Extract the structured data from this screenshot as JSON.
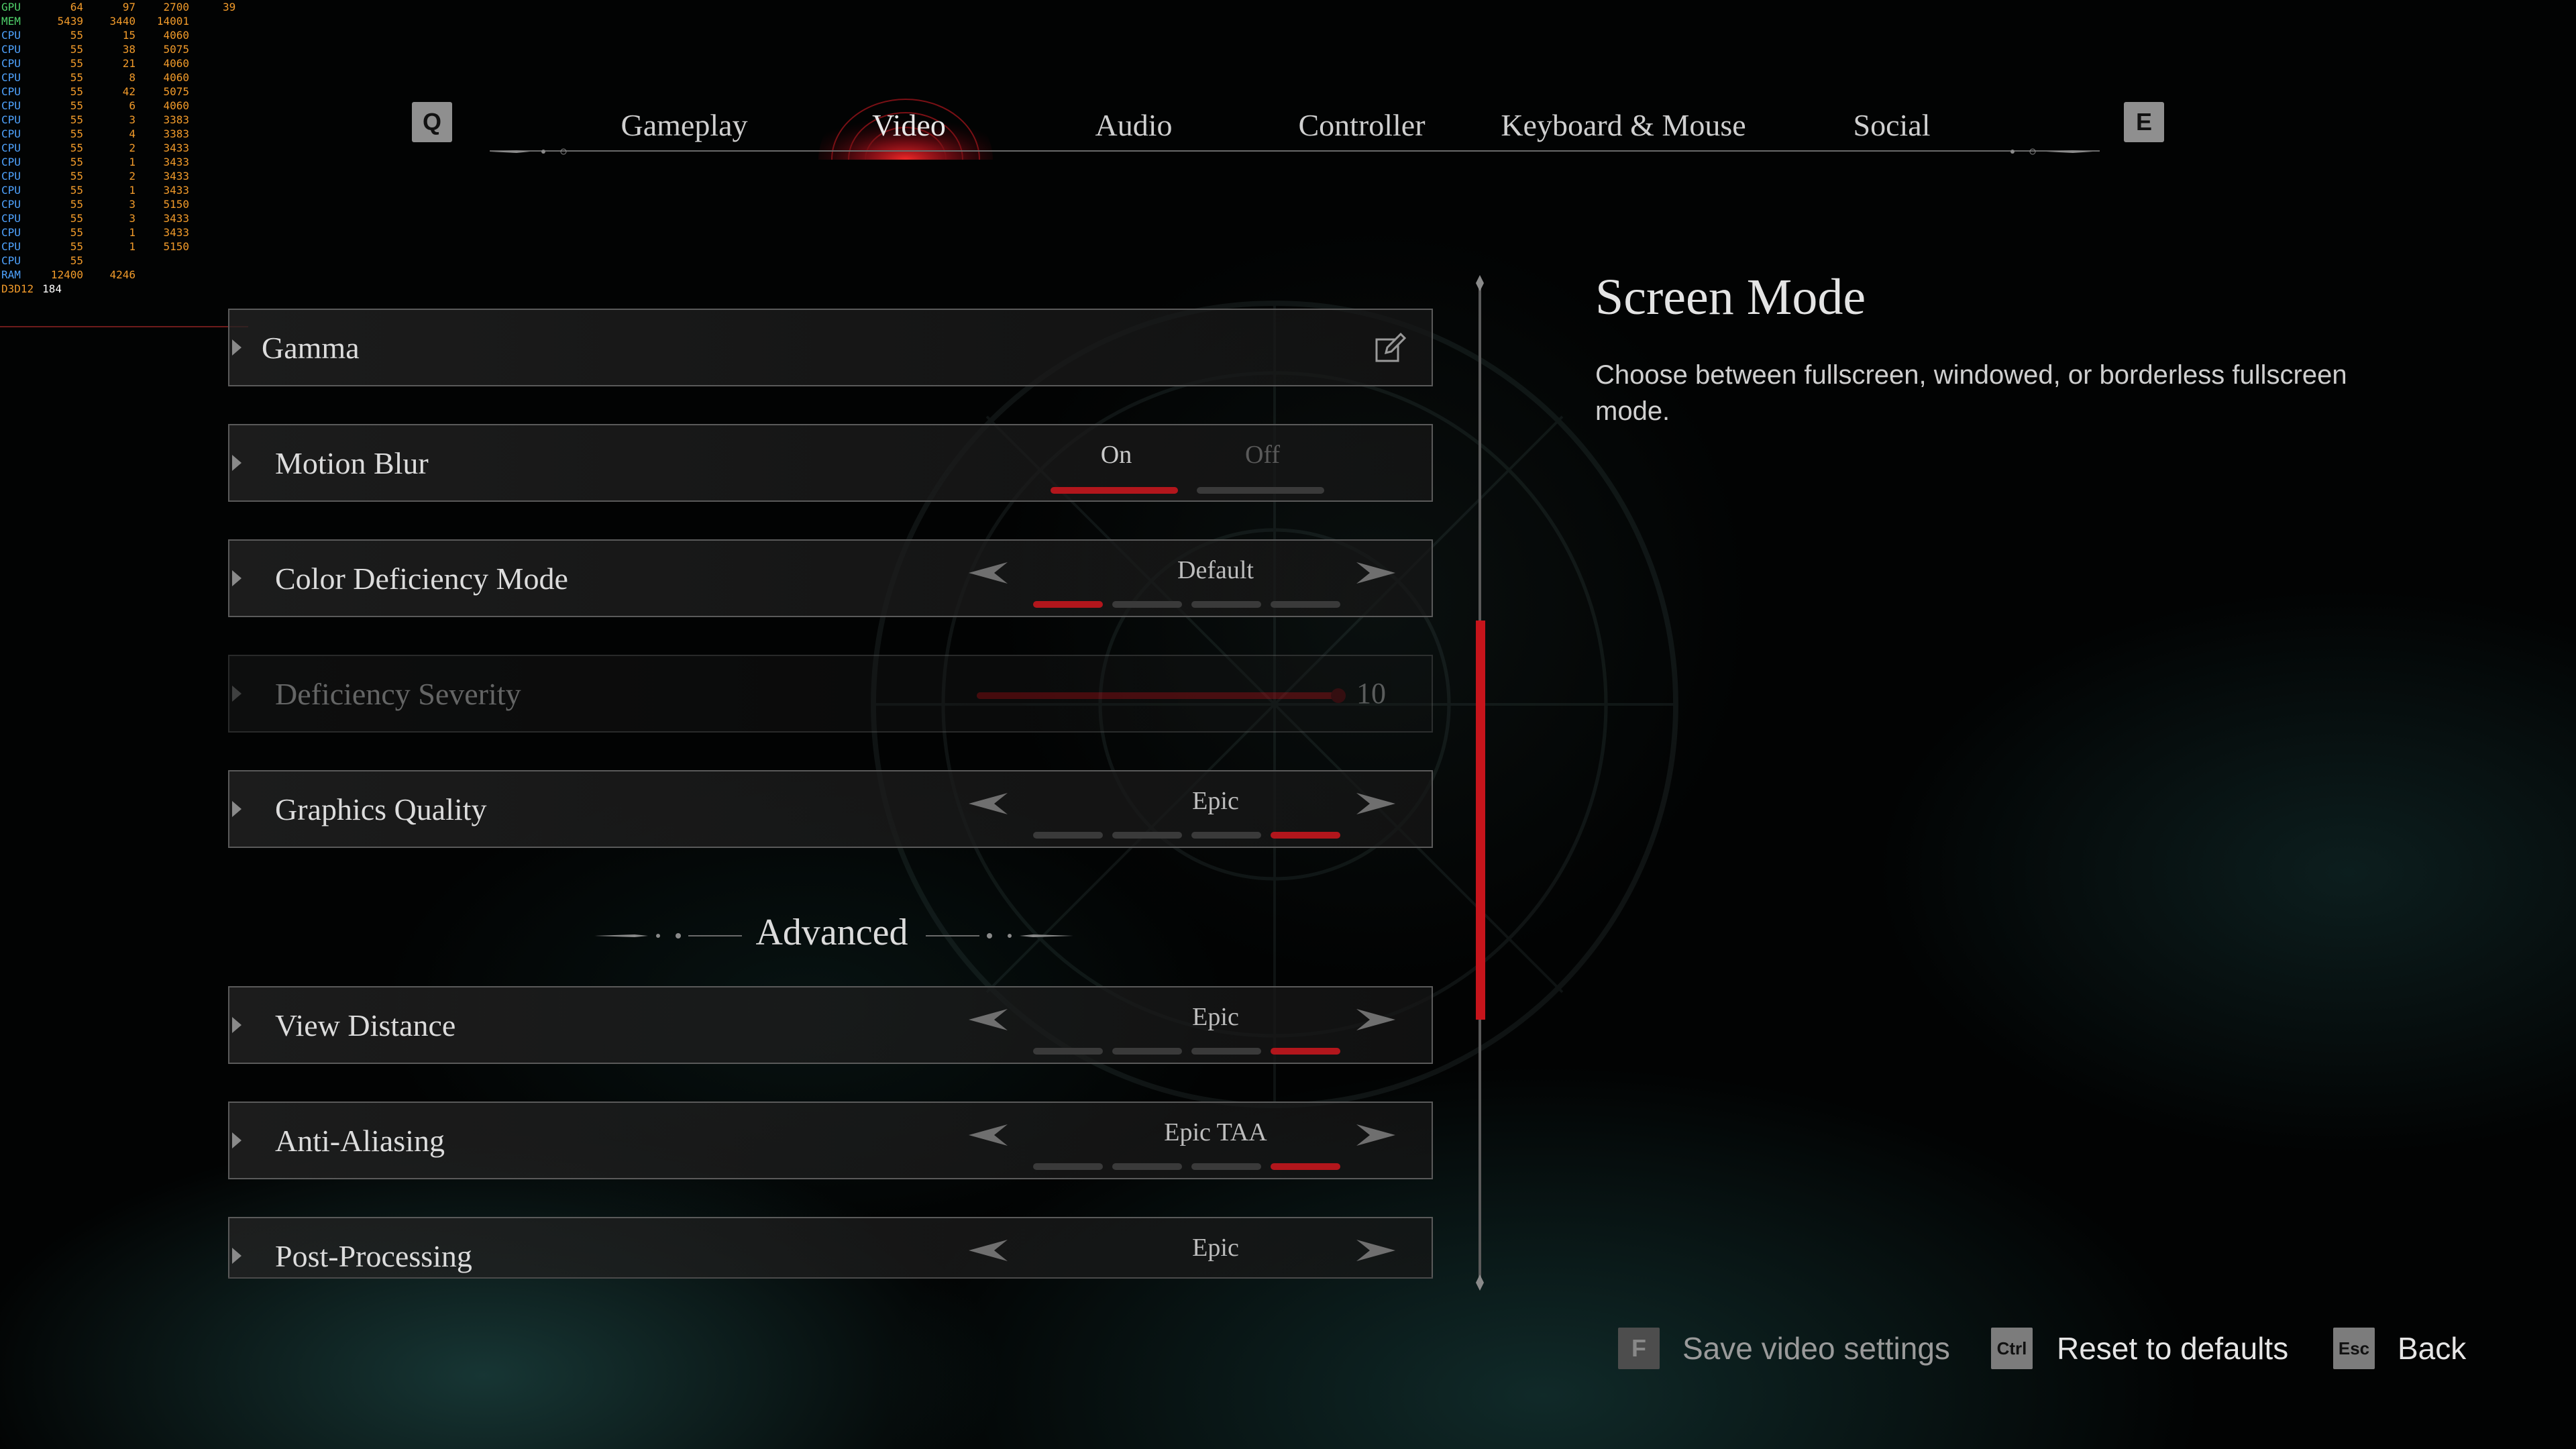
{
  "overlay": {
    "rows": [
      {
        "label": "GPU",
        "a": "64",
        "b": "97",
        "c": "2700",
        "d": "39"
      },
      {
        "label": "MEM",
        "a": "5439",
        "b": "3440",
        "c": "14001",
        "d": ""
      },
      {
        "label": "CPU",
        "a": "55",
        "b": "15",
        "c": "4060",
        "d": ""
      },
      {
        "label": "CPU",
        "a": "55",
        "b": "38",
        "c": "5075",
        "d": ""
      },
      {
        "label": "CPU",
        "a": "55",
        "b": "21",
        "c": "4060",
        "d": ""
      },
      {
        "label": "CPU",
        "a": "55",
        "b": "8",
        "c": "4060",
        "d": ""
      },
      {
        "label": "CPU",
        "a": "55",
        "b": "42",
        "c": "5075",
        "d": ""
      },
      {
        "label": "CPU",
        "a": "55",
        "b": "6",
        "c": "4060",
        "d": ""
      },
      {
        "label": "CPU",
        "a": "55",
        "b": "3",
        "c": "3383",
        "d": ""
      },
      {
        "label": "CPU",
        "a": "55",
        "b": "4",
        "c": "3383",
        "d": ""
      },
      {
        "label": "CPU",
        "a": "55",
        "b": "2",
        "c": "3433",
        "d": ""
      },
      {
        "label": "CPU",
        "a": "55",
        "b": "1",
        "c": "3433",
        "d": ""
      },
      {
        "label": "CPU",
        "a": "55",
        "b": "2",
        "c": "3433",
        "d": ""
      },
      {
        "label": "CPU",
        "a": "55",
        "b": "1",
        "c": "3433",
        "d": ""
      },
      {
        "label": "CPU",
        "a": "55",
        "b": "3",
        "c": "5150",
        "d": ""
      },
      {
        "label": "CPU",
        "a": "55",
        "b": "3",
        "c": "3433",
        "d": ""
      },
      {
        "label": "CPU",
        "a": "55",
        "b": "1",
        "c": "3433",
        "d": ""
      },
      {
        "label": "CPU",
        "a": "55",
        "b": "1",
        "c": "5150",
        "d": ""
      },
      {
        "label": "CPU",
        "a": "55",
        "b": "",
        "c": "",
        "d": ""
      },
      {
        "label": "RAM",
        "a": "12400",
        "b": "4246",
        "c": "",
        "d": ""
      },
      {
        "label": "D3D12",
        "a": "184",
        "b": "",
        "c": "",
        "d": ""
      }
    ]
  },
  "tabs": {
    "left_key": "Q",
    "right_key": "E",
    "items": [
      {
        "label": "Gameplay"
      },
      {
        "label": "Video",
        "active": true
      },
      {
        "label": "Audio"
      },
      {
        "label": "Controller"
      },
      {
        "label": "Keyboard & Mouse"
      },
      {
        "label": "Social"
      }
    ]
  },
  "settings": {
    "gamma": {
      "label": "Gamma"
    },
    "motion_blur": {
      "label": "Motion Blur",
      "on_label": "On",
      "off_label": "Off",
      "selected": "On"
    },
    "color_deficiency": {
      "label": "Color Deficiency Mode",
      "value": "Default",
      "level": 1,
      "levels": 4
    },
    "deficiency_severity": {
      "label": "Deficiency Severity",
      "value": "10",
      "fraction": 1.0,
      "disabled": true
    },
    "graphics_quality": {
      "label": "Graphics Quality",
      "value": "Epic",
      "level": 4,
      "levels": 4
    },
    "advanced_heading": "Advanced",
    "view_distance": {
      "label": "View Distance",
      "value": "Epic",
      "level": 4,
      "levels": 4
    },
    "anti_aliasing": {
      "label": "Anti-Aliasing",
      "value": "Epic TAA",
      "level": 4,
      "levels": 4
    },
    "post_processing": {
      "label": "Post-Processing",
      "value": "Epic"
    }
  },
  "info": {
    "title": "Screen Mode",
    "description": "Choose between fullscreen, windowed, or borderless fullscreen mode."
  },
  "footer": {
    "save": {
      "key": "F",
      "label": "Save video settings"
    },
    "reset": {
      "key": "Ctrl",
      "label": "Reset to defaults"
    },
    "back": {
      "key": "Esc",
      "label": "Back"
    }
  },
  "colors": {
    "accent": "#c6141b",
    "panel_border": "#5a5a5a",
    "text": "#dcdcdc"
  }
}
